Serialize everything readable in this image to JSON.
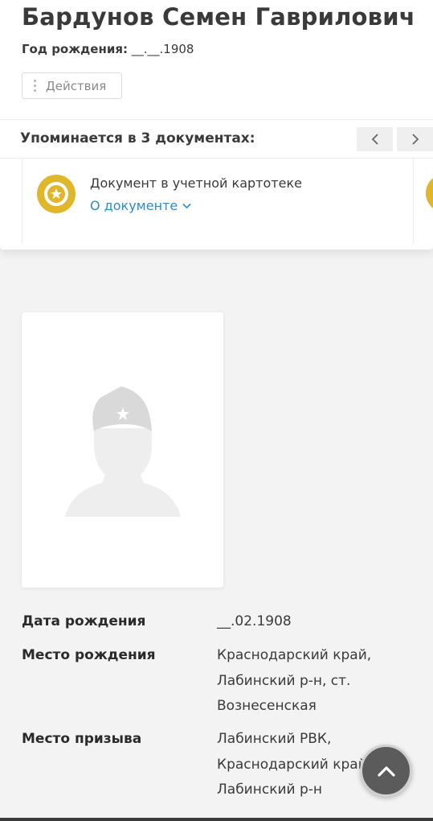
{
  "person": {
    "name": "Бардунов Семен Гаврилович",
    "birth_year_label": "Год рождения:",
    "birth_year_value": " __.__.1908"
  },
  "actions": {
    "label": "Действия"
  },
  "mentions": {
    "title": "Упоминается в 3 документах:",
    "documents": [
      {
        "type": "Документ в учетной картотеке",
        "link": "О документе"
      }
    ]
  },
  "details": {
    "birth_date": {
      "label": "Дата рождения",
      "value": [
        "__.02.1908"
      ]
    },
    "birth_place": {
      "label": "Место рождения",
      "value": [
        "Краснодарский край,",
        "Лабинский р-н, ст.",
        "Вознесенская"
      ]
    },
    "draft_place": {
      "label": "Место призыва",
      "value": [
        "Лабинский РВК,",
        "Краснодарский край,",
        "Лабинский р-н"
      ]
    }
  },
  "colors": {
    "accent": "#2f8bc9",
    "medal": "#e0b62a",
    "fab": "#5b5b5b"
  },
  "icons": {
    "actions": "vertical-dots-icon",
    "prev": "chevron-left-icon",
    "next": "chevron-right-icon",
    "document": "star-medal-icon",
    "link": "chevron-down-icon",
    "photo_placeholder": "soldier-silhouette-icon",
    "scroll_top": "chevron-up-icon"
  }
}
